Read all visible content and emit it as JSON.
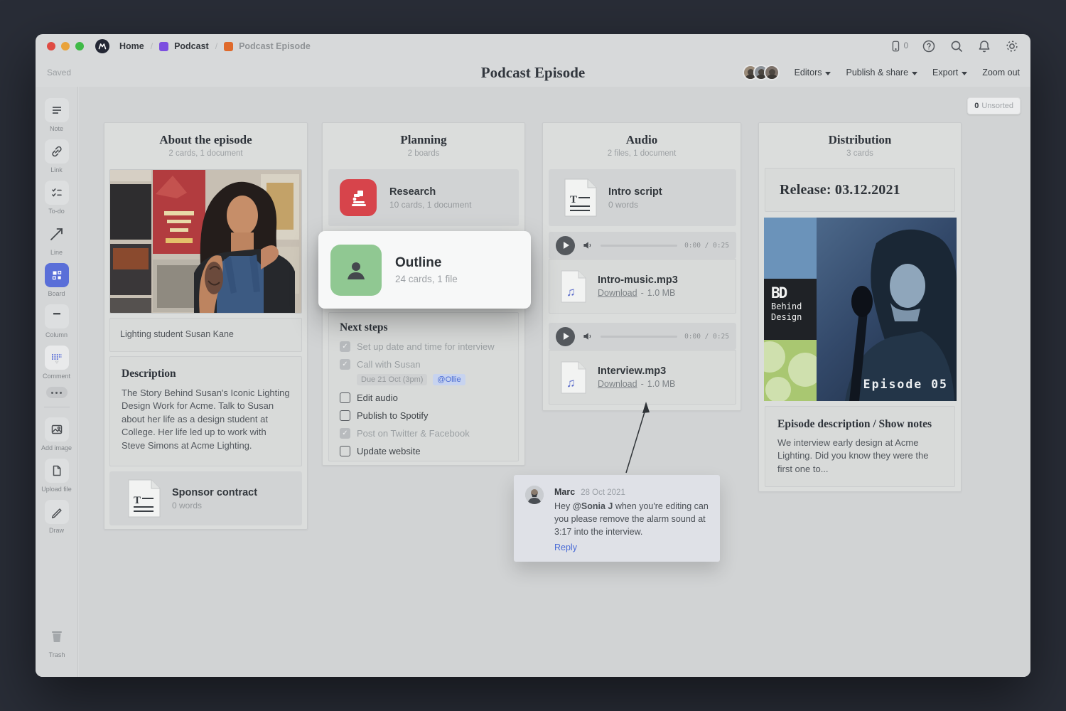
{
  "window": {
    "breadcrumb": {
      "home": "Home",
      "podcast": "Podcast",
      "current": "Podcast Episode",
      "sep": "/"
    },
    "saved": "Saved",
    "title": "Podcast Episode",
    "device_count": "0",
    "menus": {
      "editors": "Editors",
      "publish": "Publish & share",
      "export": "Export",
      "zoom_out": "Zoom out"
    }
  },
  "canvas": {
    "unsorted_count": "0",
    "unsorted_label": "Unsorted"
  },
  "sidebar": {
    "tools": [
      "Note",
      "Link",
      "To-do",
      "Line",
      "Board",
      "Column",
      "Comment"
    ],
    "tools2": [
      "Add image",
      "Upload file",
      "Draw"
    ],
    "trash": "Trash"
  },
  "boards": {
    "about": {
      "title": "About the episode",
      "subtitle": "2 cards, 1 document",
      "caption": "Lighting student Susan Kane",
      "desc_title": "Description",
      "desc_text": "The Story Behind Susan's Iconic Lighting Design Work for Acme. Talk to Susan about her life as a design student at College. Her life led up to work with Steve Simons at Acme Lighting.",
      "sponsor_title": "Sponsor contract",
      "sponsor_meta": "0 words"
    },
    "planning": {
      "title": "Planning",
      "subtitle": "2 boards",
      "research_title": "Research",
      "research_meta": "10 cards, 1 document",
      "outline_title": "Outline",
      "outline_meta": "24 cards, 1 file",
      "steps_heading": "Next steps",
      "steps": [
        {
          "label": "Set up date and time for interview",
          "checked": true
        },
        {
          "label": "Call with Susan",
          "checked": true,
          "due": "Due 21 Oct (3pm)",
          "assignee": "@Ollie"
        },
        {
          "label": "Edit audio",
          "checked": false
        },
        {
          "label": "Publish to Spotify",
          "checked": false
        },
        {
          "label": "Post on Twitter & Facebook",
          "checked": true
        },
        {
          "label": "Update website",
          "checked": false
        }
      ]
    },
    "audio": {
      "title": "Audio",
      "subtitle": "2 files, 1 document",
      "doc_title": "Intro script",
      "doc_meta": "0 words",
      "time1": "0:00 / 0:25",
      "time2": "0:00 / 0:25",
      "download": "Download",
      "sep": "-",
      "file1_name": "Intro-music.mp3",
      "file1_size": "1.0 MB",
      "file2_name": "Interview.mp3",
      "file2_size": "1.0 MB"
    },
    "distribution": {
      "title": "Distribution",
      "subtitle": "3 cards",
      "release": "Release: 03.12.2021",
      "art_brand": "BD",
      "art_line1": "Behind",
      "art_line2": "Design",
      "art_episode": "Episode 05",
      "notes_heading": "Episode description / Show notes",
      "notes_text": "We interview early design at Acme Lighting. Did you know they were the first one to..."
    }
  },
  "comment": {
    "author": "Marc",
    "date": "28 Oct 2021",
    "text_prefix": "Hey ",
    "mention": "@Sonia J",
    "text_suffix": " when you're editing can you please remove the alarm sound at 3:17 into the interview.",
    "reply": "Reply"
  },
  "colors": {
    "accent_blue": "#5a6fd8",
    "research_red": "#d7444b",
    "outline_green": "#90c892",
    "breadcrumb_purple": "#7c4fe0",
    "breadcrumb_orange": "#df6a2c",
    "canvas_gray": "#d1d3d4"
  },
  "icons": {
    "top_right": [
      "device-icon",
      "help-icon",
      "search-icon",
      "bell-icon",
      "gear-icon"
    ],
    "traffic_lights": [
      "close",
      "minimize",
      "zoom"
    ]
  }
}
